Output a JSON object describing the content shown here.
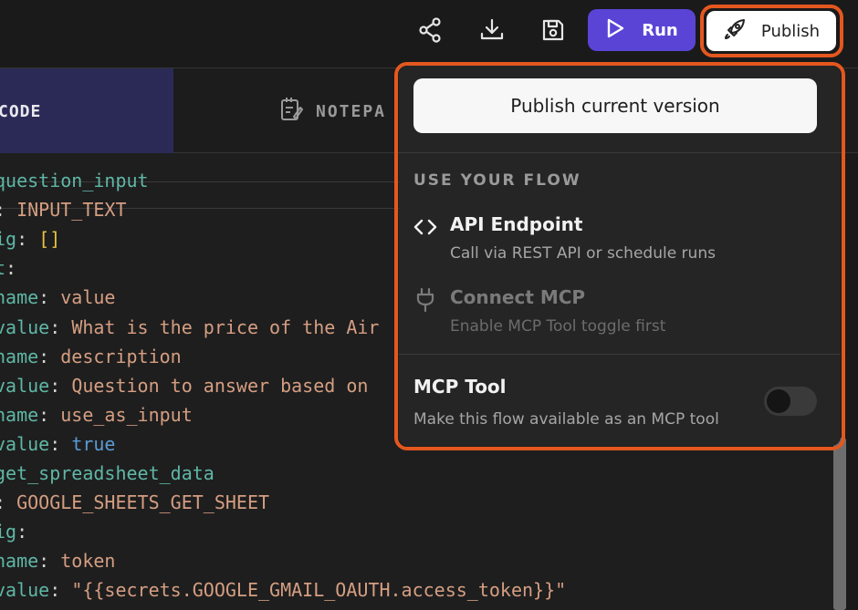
{
  "toolbar": {
    "share_icon": "share-icon",
    "download_icon": "download-icon",
    "save_icon": "save-icon",
    "run_label": "Run",
    "publish_label": "Publish",
    "run_color": "#5a44d6",
    "highlight_color": "#e4571f"
  },
  "tabs": {
    "code_label": "CODE",
    "notepad_label": "NOTEPA"
  },
  "editor": {
    "lines": [
      {
        "key": "question_input",
        "sep": "",
        "val": ""
      },
      {
        "key": ": ",
        "sep": "",
        "val": "INPUT_TEXT"
      },
      {
        "key": "ig",
        "sep": ": ",
        "val": "[]"
      },
      {
        "key": "t",
        "sep": ":",
        "val": ""
      },
      {
        "key": "name",
        "sep": ": ",
        "val": "value"
      },
      {
        "key": "value",
        "sep": ": ",
        "val": "What is the price of the Air"
      },
      {
        "key": "name",
        "sep": ": ",
        "val": "description"
      },
      {
        "key": "value",
        "sep": ": ",
        "val": "Question to answer based on"
      },
      {
        "key": "name",
        "sep": ": ",
        "val": "use_as_input"
      },
      {
        "key": "value",
        "sep": ": ",
        "val": "true"
      },
      {
        "key": "get_spreadsheet_data",
        "sep": "",
        "val": ""
      },
      {
        "key": ": ",
        "sep": "",
        "val": "GOOGLE_SHEETS_GET_SHEET"
      },
      {
        "key": "ig",
        "sep": ":",
        "val": ""
      },
      {
        "key": "name",
        "sep": ": ",
        "val": "token"
      },
      {
        "key": "value",
        "sep": ": ",
        "val": "\"{{secrets.GOOGLE_GMAIL_OAUTH.access_token}}\""
      }
    ]
  },
  "publish_menu": {
    "publish_current": "Publish current version",
    "section_title": "USE YOUR FLOW",
    "api_title": "API Endpoint",
    "api_sub": "Call via REST API or schedule runs",
    "mcp_connect_title": "Connect MCP",
    "mcp_connect_sub": "Enable MCP Tool toggle first",
    "mcp_tool_title": "MCP Tool",
    "mcp_tool_sub": "Make this flow available as an MCP tool",
    "mcp_tool_enabled": false
  }
}
